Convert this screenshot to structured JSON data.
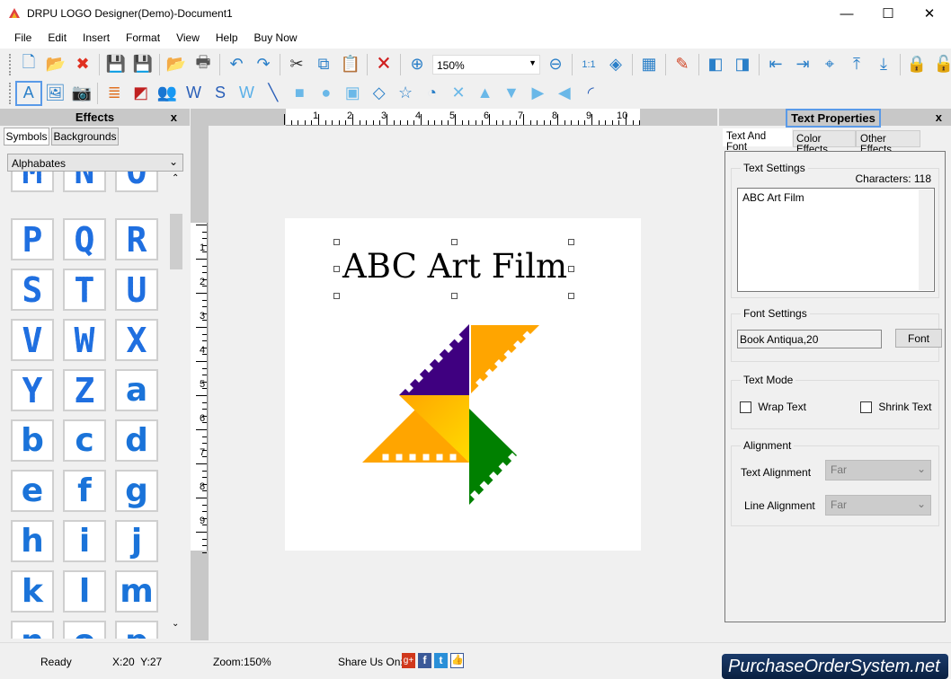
{
  "window": {
    "title": "DRPU LOGO Designer(Demo)-Document1",
    "minimize": "—",
    "maximize": "☐",
    "close": "✕"
  },
  "menu": [
    "File",
    "Edit",
    "Insert",
    "Format",
    "View",
    "Help",
    "Buy Now"
  ],
  "toolbar1": [
    {
      "icon": "new-document-icon",
      "g": "🗋",
      "c": "#2a7fc8"
    },
    {
      "icon": "open-folder-icon",
      "g": "📂",
      "c": "#e0a020"
    },
    {
      "icon": "close-document-icon",
      "g": "✖",
      "c": "#e03020"
    },
    "|",
    {
      "icon": "save-icon",
      "g": "💾",
      "c": "#2a7fc8"
    },
    {
      "icon": "save-as-icon",
      "g": "💾",
      "c": "#2a7fc8"
    },
    "|",
    {
      "icon": "export-icon",
      "g": "📂",
      "c": "#e0a020"
    },
    {
      "icon": "print-icon",
      "g": "🖶",
      "c": "#555"
    },
    "|",
    {
      "icon": "undo-icon",
      "g": "↶",
      "c": "#2a7fc8"
    },
    {
      "icon": "redo-icon",
      "g": "↷",
      "c": "#2a7fc8"
    },
    "|",
    {
      "icon": "cut-icon",
      "g": "✂",
      "c": "#333"
    },
    {
      "icon": "copy-icon",
      "g": "⧉",
      "c": "#2a7fc8"
    },
    {
      "icon": "paste-icon",
      "g": "📋",
      "c": "#999"
    },
    "|",
    {
      "icon": "delete-icon",
      "g": "🗙",
      "c": "#d02020"
    },
    "|",
    {
      "icon": "zoom-in-icon",
      "g": "⊕",
      "c": "#2a7fc8"
    },
    "ZOOM",
    {
      "icon": "zoom-out-icon",
      "g": "⊖",
      "c": "#2a7fc8"
    },
    "|",
    {
      "icon": "actual-size-icon",
      "g": "1:1",
      "c": "#2a7fc8"
    },
    {
      "icon": "fit-to-window-icon",
      "g": "◈",
      "c": "#2a7fc8"
    },
    "|",
    {
      "icon": "grid-icon",
      "g": "▦",
      "c": "#2a7fc8"
    },
    "|",
    {
      "icon": "edit-properties-icon",
      "g": "✎",
      "c": "#d04020"
    },
    "|",
    {
      "icon": "bring-to-front-icon",
      "g": "◧",
      "c": "#2a7fc8"
    },
    {
      "icon": "send-to-back-icon",
      "g": "◨",
      "c": "#2a7fc8"
    },
    "|",
    {
      "icon": "align-left-icon",
      "g": "⇤",
      "c": "#2a7fc8"
    },
    {
      "icon": "align-right-icon",
      "g": "⇥",
      "c": "#2a7fc8"
    },
    {
      "icon": "align-center-icon",
      "g": "⌖",
      "c": "#2a7fc8"
    },
    {
      "icon": "align-top-icon",
      "g": "⤒",
      "c": "#2a7fc8"
    },
    {
      "icon": "align-bottom-icon",
      "g": "⤓",
      "c": "#2a7fc8"
    },
    "|",
    {
      "icon": "lock-icon",
      "g": "🔒",
      "c": "#e0a020"
    },
    {
      "icon": "unlock-icon",
      "g": "🔓",
      "c": "#e0a020"
    }
  ],
  "zoom": {
    "value": "150%"
  },
  "toolbar2": [
    {
      "icon": "text-tool-icon",
      "g": "A",
      "c": "#2a7fc8"
    },
    {
      "icon": "insert-image-icon",
      "g": "🖼",
      "c": "#2a7fc8"
    },
    {
      "icon": "camera-icon",
      "g": "📷",
      "c": "#333"
    },
    "|",
    {
      "icon": "layers-icon",
      "g": "≣",
      "c": "#e07020"
    },
    {
      "icon": "background-icon",
      "g": "◩",
      "c": "#c02020"
    },
    {
      "icon": "clipart-icon",
      "g": "👥",
      "c": "#a04020"
    },
    {
      "icon": "wordart-icon",
      "g": "W",
      "c": "#2a5fb8"
    },
    {
      "icon": "signature-icon",
      "g": "S",
      "c": "#2a5fb8"
    },
    {
      "icon": "watermark-icon",
      "g": "W",
      "c": "#5ab0e8"
    },
    {
      "icon": "line-icon",
      "g": "╲",
      "c": "#2a5fb8"
    },
    {
      "icon": "rectangle-icon",
      "g": "■",
      "c": "#6ab8e8"
    },
    {
      "icon": "ellipse-icon",
      "g": "●",
      "c": "#6ab8e8"
    },
    {
      "icon": "rounded-rectangle-icon",
      "g": "▣",
      "c": "#6ab8e8"
    },
    {
      "icon": "diamond-icon",
      "g": "◇",
      "c": "#2a7fc8"
    },
    {
      "icon": "star-icon",
      "g": "☆",
      "c": "#2a7fc8"
    },
    {
      "icon": "pie-icon",
      "g": "◔",
      "c": "#2a7fc8"
    },
    {
      "icon": "cross-shape-icon",
      "g": "✕",
      "c": "#6ab8e8"
    },
    {
      "icon": "triangle-icon",
      "g": "▲",
      "c": "#6ab8e8"
    },
    {
      "icon": "inverted-triangle-icon",
      "g": "▼",
      "c": "#6ab8e8"
    },
    {
      "icon": "right-triangle-icon",
      "g": "▶",
      "c": "#6ab8e8"
    },
    {
      "icon": "left-triangle-icon",
      "g": "◀",
      "c": "#6ab8e8"
    },
    {
      "icon": "arc-icon",
      "g": "◜",
      "c": "#2a5fb8"
    }
  ],
  "effects": {
    "title": "Effects",
    "close": "x",
    "tabs": [
      "Symbols",
      "Backgrounds"
    ],
    "category": "Alphabates",
    "dotted": [
      "M",
      "N",
      "O",
      "P",
      "Q",
      "R",
      "S",
      "T",
      "U",
      "V",
      "W",
      "X",
      "Y",
      "Z"
    ],
    "solid": [
      "a",
      "b",
      "c",
      "d",
      "e",
      "f",
      "g",
      "h",
      "i",
      "j",
      "k",
      "l",
      "m",
      "n",
      "o",
      "p"
    ]
  },
  "ruler": {
    "top": [
      "1",
      "2",
      "3",
      "4",
      "5",
      "6",
      "7",
      "8",
      "9",
      "10"
    ],
    "left": [
      "1",
      "2",
      "3",
      "4",
      "5",
      "6",
      "7",
      "8",
      "9"
    ]
  },
  "canvas": {
    "text": "ABC Art Film",
    "logo_colors": {
      "purple": "#3f0080",
      "orange": "#ffa500",
      "yellow": "#ffc800",
      "green": "#008000"
    }
  },
  "props": {
    "title": "Text Properties",
    "close": "x",
    "tabs": [
      "Text And Font",
      "Color Effects",
      "Other Effects"
    ],
    "text_settings": "Text Settings",
    "characters": "Characters: 118",
    "text_value": "ABC Art Film",
    "font_settings": "Font Settings",
    "font_value": "Book Antiqua,20",
    "font_button": "Font",
    "text_mode": "Text Mode",
    "wrap": "Wrap Text",
    "shrink": "Shrink Text",
    "alignment": "Alignment",
    "text_align_label": "Text Alignment",
    "text_align": "Far",
    "line_align_label": "Line Alignment",
    "line_align": "Far"
  },
  "status": {
    "ready": "Ready",
    "coords": "X:20  Y:27",
    "zoom": "Zoom:150%",
    "share": "Share Us On:",
    "brand": "PurchaseOrderSystem.net"
  }
}
